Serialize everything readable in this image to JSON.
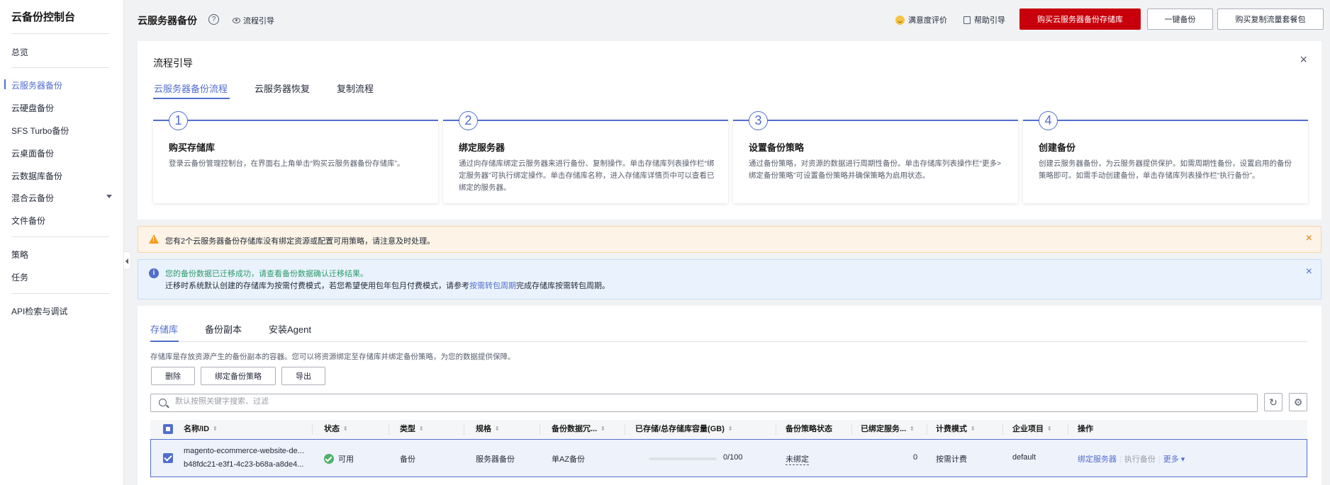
{
  "sidebar": {
    "title": "云备份控制台",
    "items": [
      {
        "label": "总览"
      },
      {
        "label": "云服务器备份"
      },
      {
        "label": "云硬盘备份"
      },
      {
        "label": "SFS Turbo备份"
      },
      {
        "label": "云桌面备份"
      },
      {
        "label": "云数据库备份"
      },
      {
        "label": "混合云备份"
      },
      {
        "label": "文件备份"
      },
      {
        "label": "策略"
      },
      {
        "label": "任务"
      },
      {
        "label": "API检索与调试"
      }
    ]
  },
  "header": {
    "title": "云服务器备份",
    "help": "?",
    "flow_guide": "流程引导",
    "satisfaction": "满意度评价",
    "help_guide": "帮助引导",
    "buy_button": "购买云服务器备份存储库",
    "one_click_button": "一键备份",
    "buy_replication_button": "购买复制流量套餐包"
  },
  "guide": {
    "title": "流程引导",
    "close": "×",
    "tabs": [
      "云服务器备份流程",
      "云服务器恢复",
      "复制流程"
    ],
    "steps": [
      {
        "num": "1",
        "title": "购买存储库",
        "desc": "登录云备份管理控制台，在界面右上角单击“购买云服务器备份存储库”。"
      },
      {
        "num": "2",
        "title": "绑定服务器",
        "desc": "通过向存储库绑定云服务器来进行备份、复制操作。单击存储库列表操作栏“绑定服务器”可执行绑定操作。单击存储库名称，进入存储库详情页中可以查看已绑定的服务器。"
      },
      {
        "num": "3",
        "title": "设置备份策略",
        "desc": "通过备份策略，对资源的数据进行周期性备份。单击存储库列表操作栏“更多>绑定备份策略”可设置备份策略并确保策略为启用状态。"
      },
      {
        "num": "4",
        "title": "创建备份",
        "desc": "创建云服务器备份，为云服务器提供保护。如需周期性备份，设置启用的备份策略即可。如需手动创建备份，单击存储库列表操作栏“执行备份”。"
      }
    ]
  },
  "alerts": {
    "warning": "您有2个云服务器备份存储库没有绑定资源或配置可用策略，请注意及时处理。",
    "info_line1": "您的备份数据已迁移成功，请查看备份数据确认迁移结果。",
    "info_line2_prefix": "迁移时系统默认创建的存储库为按需付费模式，若您希望使用包年包月付费模式，请参考",
    "info_line2_link": "按需转包周期",
    "info_line2_suffix": "完成存储库按需转包周期。",
    "close": "×"
  },
  "main": {
    "tabs": [
      "存储库",
      "备份副本",
      "安装Agent"
    ],
    "description": "存储库是存放资源产生的备份副本的容器。您可以将资源绑定至存储库并绑定备份策略，为您的数据提供保障。",
    "buttons": {
      "delete": "删除",
      "bind_policy": "绑定备份策略",
      "export": "导出"
    },
    "search_placeholder": "默认按照关键字搜索、过滤",
    "refresh_icon": "↻",
    "settings_icon": "⚙",
    "columns": [
      "名称/ID",
      "状态",
      "类型",
      "规格",
      "备份数据冗...",
      "已存储/总存储库容量(GB)",
      "备份策略状态",
      "已绑定服务...",
      "计费模式",
      "企业项目",
      "操作"
    ],
    "sort_glyph": "⇕",
    "row": {
      "name": "magento-ecommerce-website-de...",
      "id": "b48fdc21-e3f1-4c23-b68a-a8de4...",
      "status": "可用",
      "type": "备份",
      "spec": "服务器备份",
      "redundancy": "单AZ备份",
      "capacity": "0/100",
      "capacity_fraction": 0,
      "policy_status": "未绑定",
      "bound_servers": "0",
      "billing": "按需计费",
      "enterprise_project": "default",
      "op_bind": "绑定服务器",
      "op_sep": "|",
      "op_backup": "执行备份",
      "op_more": "更多 ▾"
    }
  },
  "colors": {
    "accent": "#526ecc",
    "brand_red": "#c7000b",
    "success": "#50b16b",
    "warning": "#f89a1c"
  }
}
